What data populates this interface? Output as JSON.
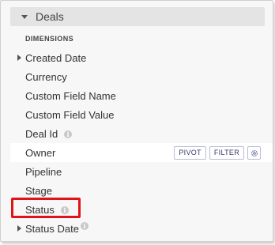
{
  "group": {
    "label": "Deals",
    "section_label": "DIMENSIONS"
  },
  "fields": [
    {
      "label": "Created Date",
      "expandable": true,
      "info": false
    },
    {
      "label": "Currency",
      "expandable": false,
      "info": false
    },
    {
      "label": "Custom Field Name",
      "expandable": false,
      "info": false
    },
    {
      "label": "Custom Field Value",
      "expandable": false,
      "info": false
    },
    {
      "label": "Deal Id",
      "expandable": false,
      "info": true
    },
    {
      "label": "Owner",
      "expandable": false,
      "info": false
    },
    {
      "label": "Pipeline",
      "expandable": false,
      "info": false
    },
    {
      "label": "Stage",
      "expandable": false,
      "info": false
    },
    {
      "label": "Status",
      "expandable": false,
      "info": true
    },
    {
      "label": "Status Date",
      "expandable": true,
      "info": true
    }
  ],
  "row_actions": {
    "pivot_label": "PIVOT",
    "filter_label": "FILTER"
  },
  "info_glyph": "i",
  "colors": {
    "highlight_border": "#e0131a",
    "pill_border": "#bcbcd8",
    "header_bg": "#e4e4e4",
    "panel_bg": "#f7f7f7"
  }
}
